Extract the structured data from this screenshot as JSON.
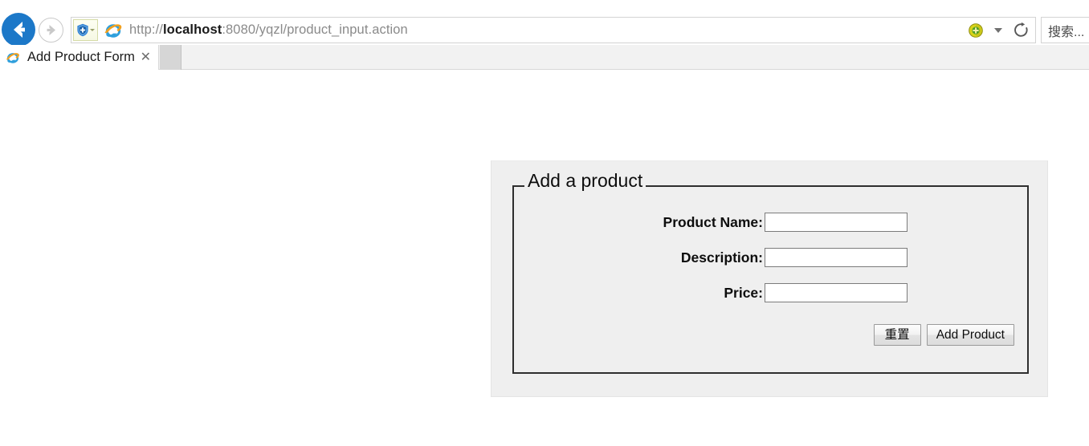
{
  "browser": {
    "back_label": "Back",
    "forward_label": "Forward",
    "back_icon": "arrow-left-icon",
    "forward_icon": "arrow-right-icon",
    "security_icon": "shield-plus-icon",
    "site_icon": "internet-explorer-icon",
    "url_scheme": "http://",
    "url_host": "localhost",
    "url_rest": ":8080/yqzl/product_input.action",
    "url_full": "http://localhost:8080/yqzl/product_input.action",
    "compat_icon": "compatibility-view-icon",
    "addr_caret_icon": "chevron-down-icon",
    "refresh_icon": "refresh-icon",
    "search_placeholder": "搜索..."
  },
  "tabs": [
    {
      "title": "Add Product Form",
      "favicon": "internet-explorer-icon",
      "close_label": "✕",
      "active": true
    }
  ],
  "new_tab_label": "",
  "form": {
    "legend": "Add a product",
    "fields": [
      {
        "label": "Product Name:",
        "value": "",
        "placeholder": ""
      },
      {
        "label": "Description:",
        "value": "",
        "placeholder": ""
      },
      {
        "label": "Price:",
        "value": "",
        "placeholder": ""
      }
    ],
    "buttons": {
      "reset_label": "重置",
      "submit_label": "Add Product"
    }
  },
  "colors": {
    "back_button": "#1c78c8",
    "panel_bg": "#efefef",
    "fieldset_border": "#2e2e2e",
    "page_bg": "#ffffff",
    "tab_bar_bg": "#f2f2f2"
  }
}
